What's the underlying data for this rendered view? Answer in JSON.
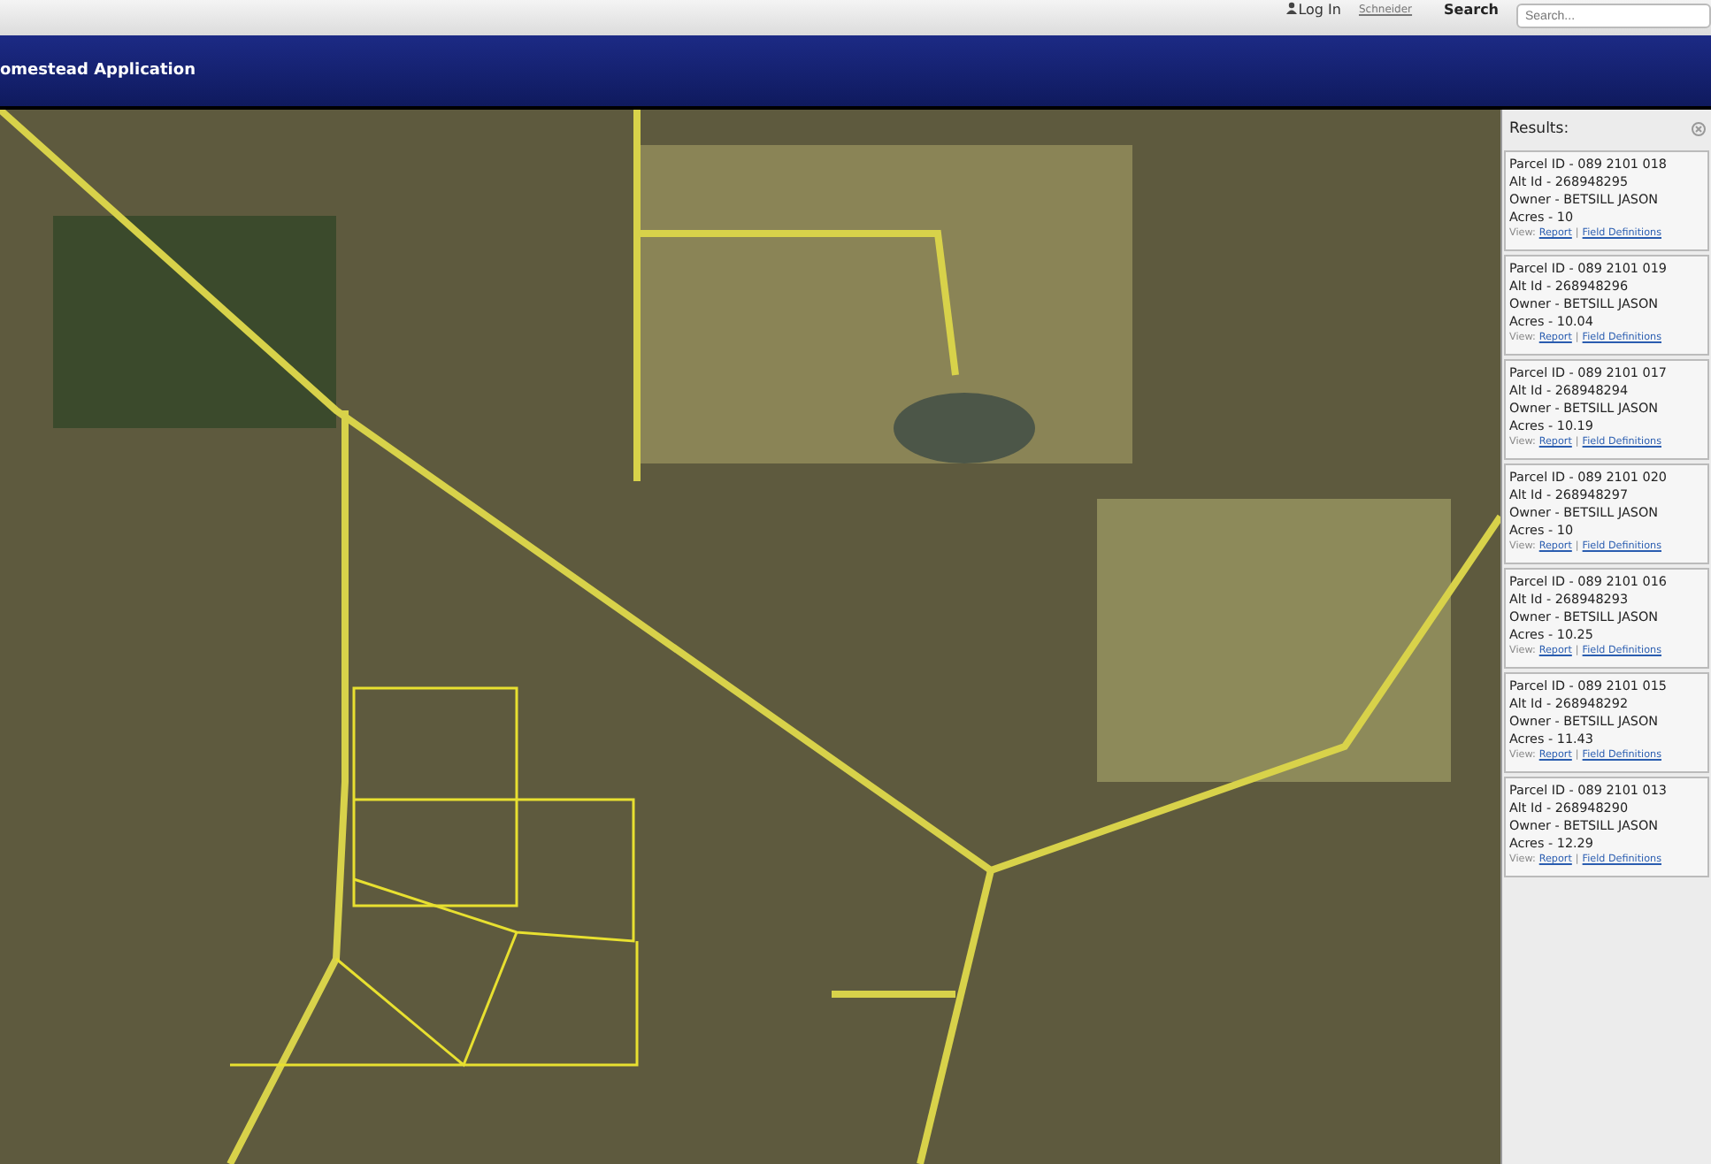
{
  "top_bar": {
    "login": "Log In",
    "logo_text": "Schneider",
    "search_label": "Search",
    "search_placeholder": "Search..."
  },
  "nav_bar": {
    "title": "omestead Application"
  },
  "results": {
    "title": "Results:",
    "items": [
      {
        "parcel": "Parcel ID - 089 2101 018",
        "alt": "Alt Id - 268948295",
        "owner": "Owner - BETSILL JASON",
        "acres": "Acres - 10",
        "view": "View:",
        "report": "Report",
        "sep": "|",
        "definitions": "Field Definitions"
      },
      {
        "parcel": "Parcel ID - 089 2101 019",
        "alt": "Alt Id - 268948296",
        "owner": "Owner - BETSILL JASON",
        "acres": "Acres - 10.04",
        "view": "View:",
        "report": "Report",
        "sep": "|",
        "definitions": "Field Definitions"
      },
      {
        "parcel": "Parcel ID - 089 2101 017",
        "alt": "Alt Id - 268948294",
        "owner": "Owner - BETSILL JASON",
        "acres": "Acres - 10.19",
        "view": "View:",
        "report": "Report",
        "sep": "|",
        "definitions": "Field Definitions"
      },
      {
        "parcel": "Parcel ID - 089 2101 020",
        "alt": "Alt Id - 268948297",
        "owner": "Owner - BETSILL JASON",
        "acres": "Acres - 10",
        "view": "View:",
        "report": "Report",
        "sep": "|",
        "definitions": "Field Definitions"
      },
      {
        "parcel": "Parcel ID - 089 2101 016",
        "alt": "Alt Id - 268948293",
        "owner": "Owner - BETSILL JASON",
        "acres": "Acres - 10.25",
        "view": "View:",
        "report": "Report",
        "sep": "|",
        "definitions": "Field Definitions"
      },
      {
        "parcel": "Parcel ID - 089 2101 015",
        "alt": "Alt Id - 268948292",
        "owner": "Owner - BETSILL JASON",
        "acres": "Acres - 11.43",
        "view": "View:",
        "report": "Report",
        "sep": "|",
        "definitions": "Field Definitions"
      },
      {
        "parcel": "Parcel ID - 089 2101 013",
        "alt": "Alt Id - 268948290",
        "owner": "Owner - BETSILL JASON",
        "acres": "Acres - 12.29",
        "view": "View:",
        "report": "Report",
        "sep": "|",
        "definitions": "Field Definitions"
      }
    ]
  }
}
